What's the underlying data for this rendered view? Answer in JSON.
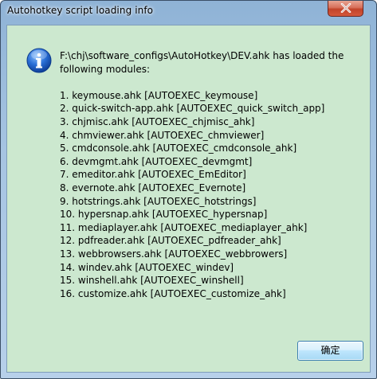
{
  "window": {
    "title": "Autohotkey script loading info"
  },
  "dialog": {
    "icon": "info-icon",
    "message_line1": "F:\\chj\\software_configs\\AutoHotkey\\DEV.ahk has loaded the",
    "message_line2": "following modules:",
    "modules": [
      "1. keymouse.ahk [AUTOEXEC_keymouse]",
      "2. quick-switch-app.ahk [AUTOEXEC_quick_switch_app]",
      "3. chjmisc.ahk [AUTOEXEC_chjmisc_ahk]",
      "4. chmviewer.ahk [AUTOEXEC_chmviewer]",
      "5. cmdconsole.ahk [AUTOEXEC_cmdconsole_ahk]",
      "6. devmgmt.ahk [AUTOEXEC_devmgmt]",
      "7. emeditor.ahk [AUTOEXEC_EmEditor]",
      "8. evernote.ahk [AUTOEXEC_Evernote]",
      "9. hotstrings.ahk [AUTOEXEC_hotstrings]",
      "10. hypersnap.ahk [AUTOEXEC_hypersnap]",
      "11. mediaplayer.ahk [AUTOEXEC_mediaplayer_ahk]",
      "12. pdfreader.ahk [AUTOEXEC_pdfreader_ahk]",
      "13. webbrowsers.ahk [AUTOEXEC_webbrowers]",
      "14. windev.ahk [AUTOEXEC_windev]",
      "15. winshell.ahk [AUTOEXEC_winshell]",
      "16. customize.ahk [AUTOEXEC_customize_ahk]"
    ],
    "ok_label": "确定"
  },
  "colors": {
    "client_background": "#cce8cf",
    "close_button": "#c2432a",
    "frame": "#a6c4e2"
  }
}
